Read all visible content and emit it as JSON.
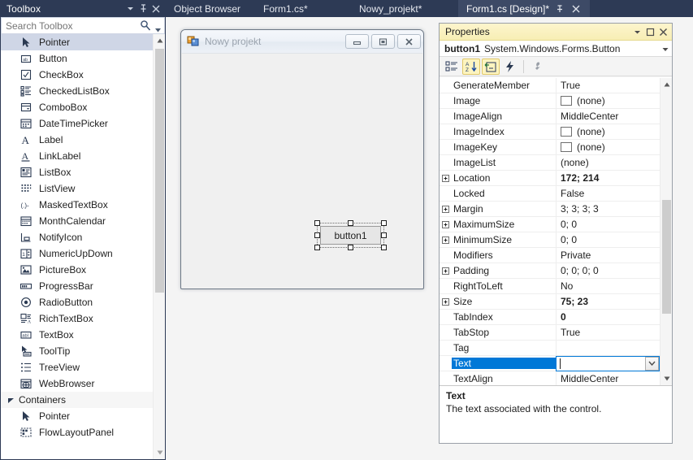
{
  "toolbox": {
    "title": "Toolbox",
    "header_buttons": [
      {
        "name": "dropdown-icon",
        "glyph": "chevron-down"
      },
      {
        "name": "pin-icon",
        "glyph": "pin"
      },
      {
        "name": "close-icon",
        "glyph": "close"
      }
    ],
    "search": {
      "placeholder": "Search Toolbox",
      "value": "",
      "icon": "search-icon",
      "caret_icon": "chevron-down-icon"
    },
    "items": [
      {
        "label": "Pointer",
        "icon": "pointer-icon",
        "selected": true
      },
      {
        "label": "Button",
        "icon": "button-icon",
        "selected": false
      },
      {
        "label": "CheckBox",
        "icon": "checkbox-icon",
        "selected": false
      },
      {
        "label": "CheckedListBox",
        "icon": "checkedlistbox-icon",
        "selected": false
      },
      {
        "label": "ComboBox",
        "icon": "combobox-icon",
        "selected": false
      },
      {
        "label": "DateTimePicker",
        "icon": "datetimepicker-icon",
        "selected": false
      },
      {
        "label": "Label",
        "icon": "label-icon",
        "selected": false
      },
      {
        "label": "LinkLabel",
        "icon": "linklabel-icon",
        "selected": false
      },
      {
        "label": "ListBox",
        "icon": "listbox-icon",
        "selected": false
      },
      {
        "label": "ListView",
        "icon": "listview-icon",
        "selected": false
      },
      {
        "label": "MaskedTextBox",
        "icon": "maskedtextbox-icon",
        "selected": false
      },
      {
        "label": "MonthCalendar",
        "icon": "monthcalendar-icon",
        "selected": false
      },
      {
        "label": "NotifyIcon",
        "icon": "notifyicon-icon",
        "selected": false
      },
      {
        "label": "NumericUpDown",
        "icon": "numericupdown-icon",
        "selected": false
      },
      {
        "label": "PictureBox",
        "icon": "picturebox-icon",
        "selected": false
      },
      {
        "label": "ProgressBar",
        "icon": "progressbar-icon",
        "selected": false
      },
      {
        "label": "RadioButton",
        "icon": "radiobutton-icon",
        "selected": false
      },
      {
        "label": "RichTextBox",
        "icon": "richtextbox-icon",
        "selected": false
      },
      {
        "label": "TextBox",
        "icon": "textbox-icon",
        "selected": false
      },
      {
        "label": "ToolTip",
        "icon": "tooltip-icon",
        "selected": false
      },
      {
        "label": "TreeView",
        "icon": "treeview-icon",
        "selected": false
      },
      {
        "label": "WebBrowser",
        "icon": "webbrowser-icon",
        "selected": false
      }
    ],
    "group": {
      "label": "Containers",
      "expanded": true
    },
    "group_items": [
      {
        "label": "Pointer",
        "icon": "pointer-icon"
      },
      {
        "label": "FlowLayoutPanel",
        "icon": "flowlayoutpanel-icon"
      }
    ]
  },
  "tabs": [
    {
      "label": "Object Browser",
      "active": false
    },
    {
      "label": "Form1.cs*",
      "active": false
    },
    {
      "label": "Nowy_projekt*",
      "active": false
    },
    {
      "label": "Form1.cs [Design]*",
      "active": true,
      "pin_icon": "pin-icon",
      "close_icon": "close-icon"
    }
  ],
  "designer": {
    "form": {
      "title": "Nowy projekt",
      "icon": "form-icon",
      "minimize_label": "Minimize",
      "maximize_label": "Maximize",
      "close_label": "Close"
    },
    "selected_control": {
      "text": "button1",
      "name": "button1"
    }
  },
  "properties": {
    "title": "Properties",
    "header_buttons": [
      {
        "name": "dropdown-icon"
      },
      {
        "name": "maximize-icon"
      },
      {
        "name": "close-icon"
      }
    ],
    "object_name": "button1",
    "object_type": "System.Windows.Forms.Button",
    "object_dropdown_icon": "chevron-down-icon",
    "toolbar": [
      {
        "name": "categorized-view-button",
        "active": false
      },
      {
        "name": "alphabetical-view-button",
        "active": true
      },
      {
        "name": "properties-button",
        "active": true
      },
      {
        "name": "events-button",
        "active": false
      },
      {
        "name": "property-pages-button",
        "active": false
      }
    ],
    "rows": [
      {
        "name": "GenerateMember",
        "value": "True",
        "expandable": false,
        "bold": false,
        "swatch": false
      },
      {
        "name": "Image",
        "value": "(none)",
        "expandable": false,
        "bold": false,
        "swatch": true
      },
      {
        "name": "ImageAlign",
        "value": "MiddleCenter",
        "expandable": false,
        "bold": false,
        "swatch": false
      },
      {
        "name": "ImageIndex",
        "value": "(none)",
        "expandable": false,
        "bold": false,
        "swatch": true
      },
      {
        "name": "ImageKey",
        "value": "(none)",
        "expandable": false,
        "bold": false,
        "swatch": true
      },
      {
        "name": "ImageList",
        "value": "(none)",
        "expandable": false,
        "bold": false,
        "swatch": false
      },
      {
        "name": "Location",
        "value": "172; 214",
        "expandable": true,
        "bold": true,
        "swatch": false
      },
      {
        "name": "Locked",
        "value": "False",
        "expandable": false,
        "bold": false,
        "swatch": false
      },
      {
        "name": "Margin",
        "value": "3; 3; 3; 3",
        "expandable": true,
        "bold": false,
        "swatch": false
      },
      {
        "name": "MaximumSize",
        "value": "0; 0",
        "expandable": true,
        "bold": false,
        "swatch": false
      },
      {
        "name": "MinimumSize",
        "value": "0; 0",
        "expandable": true,
        "bold": false,
        "swatch": false
      },
      {
        "name": "Modifiers",
        "value": "Private",
        "expandable": false,
        "bold": false,
        "swatch": false
      },
      {
        "name": "Padding",
        "value": "0; 0; 0; 0",
        "expandable": true,
        "bold": false,
        "swatch": false
      },
      {
        "name": "RightToLeft",
        "value": "No",
        "expandable": false,
        "bold": false,
        "swatch": false
      },
      {
        "name": "Size",
        "value": "75; 23",
        "expandable": true,
        "bold": true,
        "swatch": false
      },
      {
        "name": "TabIndex",
        "value": "0",
        "expandable": false,
        "bold": true,
        "swatch": false
      },
      {
        "name": "TabStop",
        "value": "True",
        "expandable": false,
        "bold": false,
        "swatch": false
      },
      {
        "name": "Tag",
        "value": "",
        "expandable": false,
        "bold": false,
        "swatch": false
      },
      {
        "name": "Text",
        "value": "",
        "expandable": false,
        "bold": false,
        "swatch": false,
        "selected": true,
        "editing": true,
        "dropdown_icon": "chevron-down-icon"
      },
      {
        "name": "TextAlign",
        "value": "MiddleCenter",
        "expandable": false,
        "bold": false,
        "swatch": false
      }
    ],
    "description": {
      "title": "Text",
      "text": "The text associated with the control."
    }
  },
  "colors": {
    "chrome": "#2d3a55",
    "tab_active": "#3d4a66",
    "properties_title": "#f7eeb4",
    "selection": "#0078d7",
    "toolbox_selected": "#cfd6e6",
    "designer_bg": "#f4f4f4"
  }
}
